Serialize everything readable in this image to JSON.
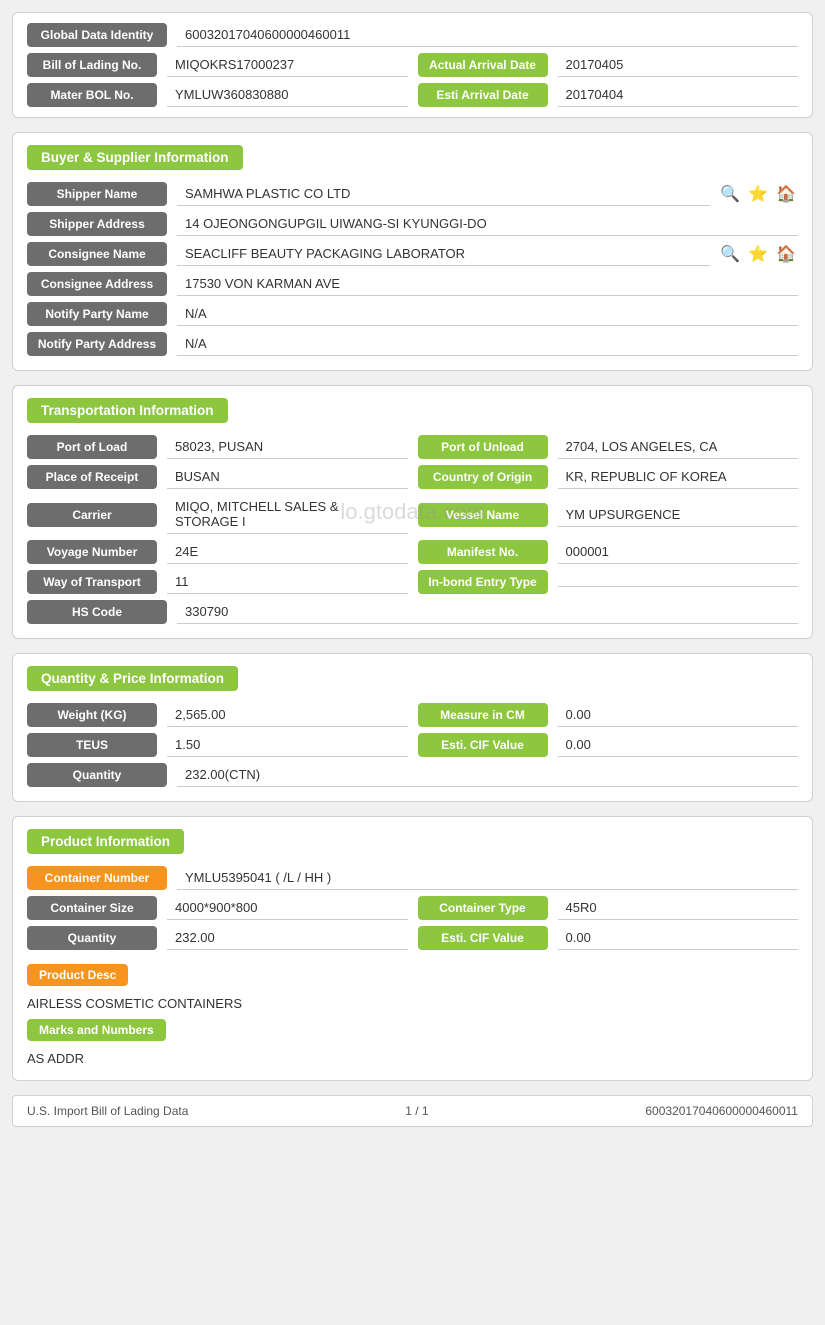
{
  "identity": {
    "global_id_label": "Global Data Identity",
    "global_id_value": "60032017040600000460011",
    "bol_label": "Bill of Lading No.",
    "bol_value": "MIQOKRS17000237",
    "actual_arrival_label": "Actual Arrival Date",
    "actual_arrival_value": "20170405",
    "mater_bol_label": "Mater BOL No.",
    "mater_bol_value": "YMLUW360830880",
    "esti_arrival_label": "Esti Arrival Date",
    "esti_arrival_value": "20170404"
  },
  "buyer_supplier": {
    "section_label": "Buyer & Supplier Information",
    "shipper_name_label": "Shipper Name",
    "shipper_name_value": "SAMHWA PLASTIC CO LTD",
    "shipper_address_label": "Shipper Address",
    "shipper_address_value": "14 OJEONGONGUPGIL UIWANG-SI KYUNGGI-DO",
    "consignee_name_label": "Consignee Name",
    "consignee_name_value": "SEACLIFF BEAUTY PACKAGING LABORATOR",
    "consignee_address_label": "Consignee Address",
    "consignee_address_value": "17530 VON KARMAN AVE",
    "notify_party_name_label": "Notify Party Name",
    "notify_party_name_value": "N/A",
    "notify_party_address_label": "Notify Party Address",
    "notify_party_address_value": "N/A"
  },
  "transportation": {
    "section_label": "Transportation Information",
    "port_load_label": "Port of Load",
    "port_load_value": "58023, PUSAN",
    "port_unload_label": "Port of Unload",
    "port_unload_value": "2704, LOS ANGELES, CA",
    "place_receipt_label": "Place of Receipt",
    "place_receipt_value": "BUSAN",
    "country_origin_label": "Country of Origin",
    "country_origin_value": "KR, REPUBLIC OF KOREA",
    "carrier_label": "Carrier",
    "carrier_value": "MIQO, MITCHELL SALES & STORAGE I",
    "vessel_name_label": "Vessel Name",
    "vessel_name_value": "YM UPSURGENCE",
    "voyage_number_label": "Voyage Number",
    "voyage_number_value": "24E",
    "manifest_no_label": "Manifest No.",
    "manifest_no_value": "000001",
    "way_transport_label": "Way of Transport",
    "way_transport_value": "11",
    "inbond_entry_label": "In-bond Entry Type",
    "inbond_entry_value": "",
    "hs_code_label": "HS Code",
    "hs_code_value": "330790",
    "watermark": "lo.gtodata.com"
  },
  "quantity_price": {
    "section_label": "Quantity & Price Information",
    "weight_label": "Weight (KG)",
    "weight_value": "2,565.00",
    "measure_label": "Measure in CM",
    "measure_value": "0.00",
    "teus_label": "TEUS",
    "teus_value": "1.50",
    "esti_cif_label": "Esti. CIF Value",
    "esti_cif_value": "0.00",
    "quantity_label": "Quantity",
    "quantity_value": "232.00(CTN)"
  },
  "product_info": {
    "section_label": "Product Information",
    "container_number_label": "Container Number",
    "container_number_value": "YMLU5395041 ( /L / HH )",
    "container_size_label": "Container Size",
    "container_size_value": "4000*900*800",
    "container_type_label": "Container Type",
    "container_type_value": "45R0",
    "quantity_label": "Quantity",
    "quantity_value": "232.00",
    "esti_cif_label": "Esti. CIF Value",
    "esti_cif_value": "0.00",
    "product_desc_label": "Product Desc",
    "product_desc_value": "AIRLESS COSMETIC CONTAINERS",
    "marks_numbers_label": "Marks and Numbers",
    "marks_numbers_value": "AS ADDR"
  },
  "footer": {
    "left": "U.S. Import Bill of Lading Data",
    "center": "1 / 1",
    "right": "60032017040600000460011"
  }
}
